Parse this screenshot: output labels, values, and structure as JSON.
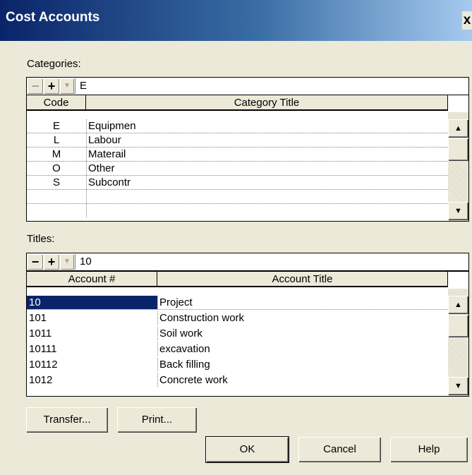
{
  "window": {
    "title": "Cost Accounts",
    "close_glyph": "x"
  },
  "categories": {
    "label": "Categories:",
    "toolbar": {
      "remove": "−",
      "add": "+",
      "dropdown": "▼",
      "value": "E"
    },
    "columns": [
      "Code",
      "Category Title"
    ],
    "rows": [
      {
        "code": "E",
        "title": "Equipmen"
      },
      {
        "code": "L",
        "title": "Labour"
      },
      {
        "code": "M",
        "title": "Materail"
      },
      {
        "code": "O",
        "title": "Other"
      },
      {
        "code": "S",
        "title": "Subcontr"
      },
      {
        "code": "",
        "title": ""
      }
    ]
  },
  "titles": {
    "label": "Titles:",
    "toolbar": {
      "remove": "−",
      "add": "+",
      "dropdown": "▼",
      "value": "10"
    },
    "columns": [
      "Account #",
      "Account Title"
    ],
    "rows": [
      {
        "account": "10",
        "title": "Project"
      },
      {
        "account": "101",
        "title": "Construction work"
      },
      {
        "account": "1011",
        "title": "Soil work"
      },
      {
        "account": "10111",
        "title": "excavation"
      },
      {
        "account": "10112",
        "title": "Back filling"
      },
      {
        "account": "1012",
        "title": "Concrete work"
      }
    ]
  },
  "scroll": {
    "up": "▲",
    "down": "▼"
  },
  "buttons": {
    "transfer": "Transfer...",
    "print": "Print...",
    "ok": "OK",
    "cancel": "Cancel",
    "help": "Help"
  },
  "colors": {
    "title_start": "#0A246A",
    "title_end": "#A6CAF0",
    "selection": "#0A246A",
    "face": "#ECE9D8"
  }
}
